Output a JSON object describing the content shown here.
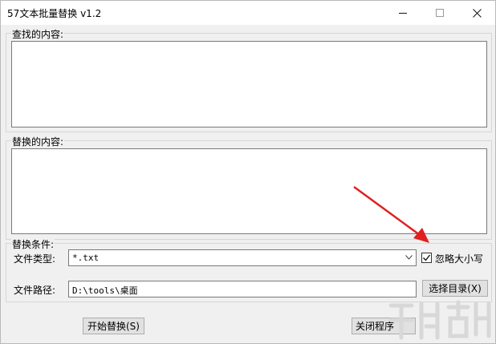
{
  "window": {
    "title": "57文本批量替换 v1.2",
    "controls": [
      "minimize-icon",
      "maximize-icon",
      "close-icon"
    ]
  },
  "find_group": {
    "label": "查找的内容:",
    "value": ""
  },
  "replace_group": {
    "label": "替换的内容:",
    "value": ""
  },
  "conditions_group": {
    "label": "替换条件:",
    "file_type_label": "文件类型:",
    "file_type_value": "*.txt",
    "ignore_case_label": "忽略大小写",
    "ignore_case_checked": true,
    "file_path_label": "文件路径:",
    "file_path_value": "D:\\tools\\桌面",
    "browse_button": "选择目录(X)"
  },
  "actions": {
    "start_button": "开始替换(S)",
    "close_button": "关闭程序"
  },
  "colors": {
    "window_bg": "#f0f0f0",
    "annotation_arrow": "#e02020"
  }
}
